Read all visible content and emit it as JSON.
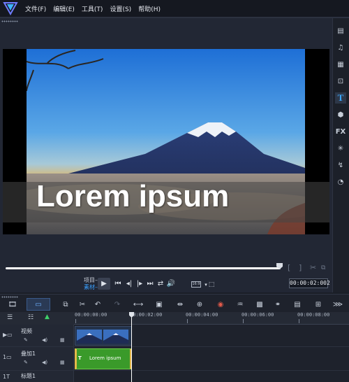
{
  "menu": {
    "items": [
      "文件(F)",
      "编辑(E)",
      "工具(T)",
      "设置(S)",
      "帮助(H)"
    ]
  },
  "preview": {
    "title_text": "Lorem ipsum",
    "mode_project": "项目–",
    "mode_clip": "素材–",
    "aspect_label": "16:9",
    "timecode": "00:00:02:002",
    "scrub_progress": 0.98
  },
  "right_toolbar": {
    "fx_label": "FX",
    "title_label": "T"
  },
  "timeline": {
    "ruler_labels": [
      "00:00:00:00",
      "00:00:02:00",
      "00:00:04:00",
      "00:00:06:00",
      "00:00:08:00"
    ],
    "tracks": [
      {
        "name": "视频"
      },
      {
        "name": "叠加1"
      },
      {
        "name": "标题1"
      }
    ],
    "overlay_clip_label": "Lorem ipsum",
    "overlay_clip_marker": "T"
  },
  "colors": {
    "accent": "#3aa0ff",
    "overlay_clip": "#3a9a2a",
    "background": "#1a1e26"
  }
}
